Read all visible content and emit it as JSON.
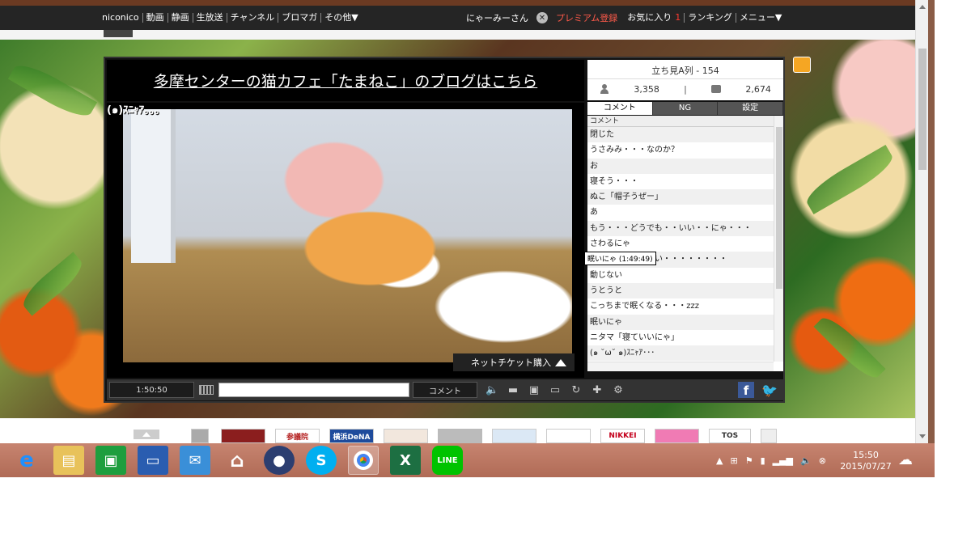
{
  "topnav": {
    "items": [
      "niconico",
      "動画",
      "静画",
      "生放送",
      "チャンネル",
      "ブロマガ",
      "その他▼"
    ],
    "user": "にゃーみーさん",
    "premium": "プレミアム登録",
    "favorites": "お気に入り",
    "fav_count": "1",
    "ranking": "ランキング",
    "menu": "メニュー▼"
  },
  "banner": {
    "text": "多摩センターの猫カフェ「たまねこ」のブログはこちら"
  },
  "video": {
    "overlay": "(๑)ｽﾆｬｱ｡｡｡",
    "ticket": "ネットチケット購入"
  },
  "info": {
    "seat": "立ち見A列 - 154",
    "viewers": "3,358",
    "comments": "2,674"
  },
  "tabs": [
    "コメント",
    "NG",
    "設定"
  ],
  "comment_header": "コメント",
  "comments": [
    "閉じた",
    "うさみみ・・・なのか？",
    "お",
    "寝そう・・・",
    "ぬこ「帽子うぜー」",
    "あ",
    "もう・・・どうでも・・いい・・にゃ・・・",
    "さわるにゃ",
    "あぁ・・・かわいい・・・・・・・・",
    "動じない",
    "うとうと",
    "こっちまで眠くなる・・・zzz",
    "眠いにゃ",
    "ニタマ「寝ていいにゃ」",
    "(๑ ˘ω˘ ๑)ｽﾆｬｱ･･･"
  ],
  "tooltip": "眠いにゃ (1:49:49)",
  "controls": {
    "time": "1:50:50",
    "comment_button": "コメント"
  },
  "ads": [
    "",
    "参議院",
    "横浜DeNA",
    "",
    "",
    "",
    "",
    "NIKKEI",
    "",
    "TOS"
  ],
  "clock": {
    "time": "15:50",
    "date": "2015/07/27"
  },
  "colors": {
    "premium": "#ff5a4a",
    "nav_bg": "#252525",
    "taskbar": "#b06b56",
    "facebook": "#3b5998",
    "twitter": "#1da1f2"
  }
}
